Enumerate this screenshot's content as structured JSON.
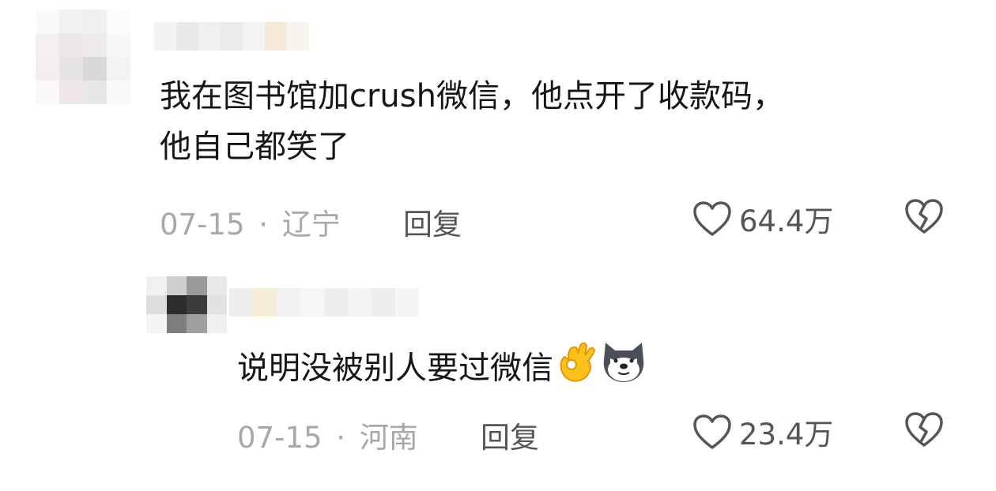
{
  "comments": [
    {
      "text_line1": "我在图书馆加crush微信，他点开了收款码，",
      "text_line2": "他自己都笑了",
      "date": "07-15",
      "separator": "·",
      "location": "辽宁",
      "reply_label": "回复",
      "likes": "64.4万",
      "icons": {
        "like": "heart-outline-icon",
        "dislike": "broken-heart-icon"
      }
    },
    {
      "text": "说明没被别人要过微信",
      "emojis": [
        "ok-hand-emoji",
        "husky-dog-emoji"
      ],
      "date": "07-15",
      "separator": "·",
      "location": "河南",
      "reply_label": "回复",
      "likes": "23.4万",
      "icons": {
        "like": "heart-outline-icon",
        "dislike": "broken-heart-icon"
      }
    }
  ],
  "colors": {
    "text": "#161616",
    "meta": "#a8a8a8",
    "action": "#555555",
    "background": "#ffffff"
  }
}
